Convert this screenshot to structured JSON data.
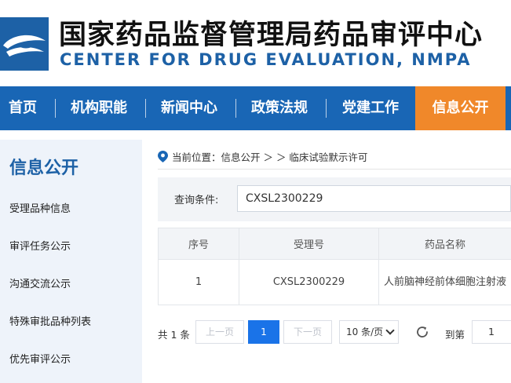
{
  "header": {
    "title_cn": "国家药品监督管理局药品审评中心",
    "title_en": "CENTER FOR DRUG EVALUATION, NMPA",
    "logo_icon": "cde-logo-icon"
  },
  "nav": {
    "items": [
      "首页",
      "机构职能",
      "新闻中心",
      "政策法规",
      "党建工作",
      "信息公开"
    ],
    "active": "信息公开",
    "bg_color": "#1966b5",
    "active_color": "#f0882a"
  },
  "sidebar": {
    "title": "信息公开",
    "items": [
      "受理品种信息",
      "审评任务公示",
      "沟通交流公示",
      "特殊审批品种列表",
      "优先审评公示"
    ]
  },
  "breadcrumb": {
    "prefix": "当前位置：信息公开 ＞ ＞ 临床试验默示许可"
  },
  "query": {
    "label": "查询条件:",
    "value": "CXSL2300229"
  },
  "table": {
    "headers": [
      "序号",
      "受理号",
      "药品名称"
    ],
    "rows": [
      [
        "1",
        "CXSL2300229",
        "人前脑神经前体细胞注射液"
      ]
    ]
  },
  "pager": {
    "total": "共 1 条",
    "prev": "上一页",
    "current": "1",
    "next": "下一页",
    "page_size": "10 条/页",
    "goto": "到第",
    "goto_value": "1"
  }
}
